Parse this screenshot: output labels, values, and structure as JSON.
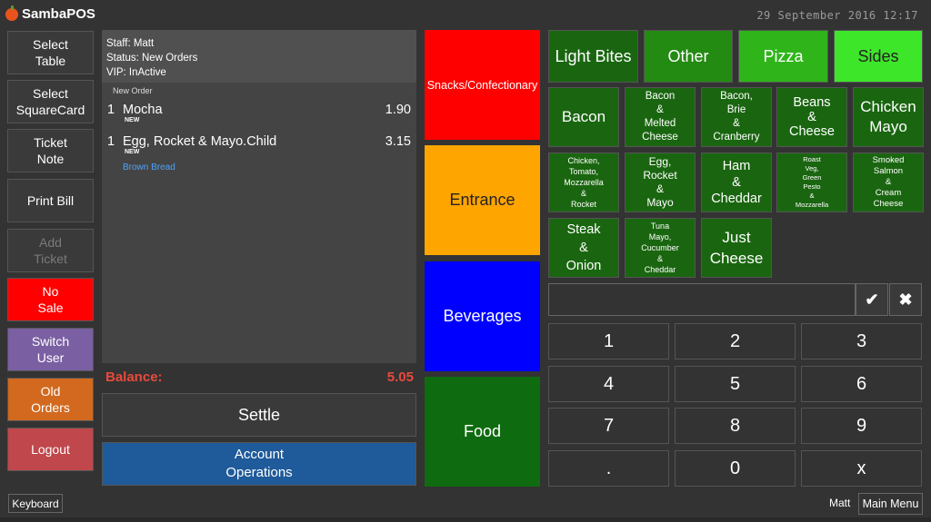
{
  "app": {
    "title": "SambaPOS",
    "datetime": "29 September 2016 12:17"
  },
  "left_buttons": [
    {
      "label": "Select\nTable",
      "color": "#3a3a3a"
    },
    {
      "label": "Select\nSquareCard",
      "color": "#3a3a3a"
    },
    {
      "label": "Ticket\nNote",
      "color": "#3a3a3a"
    },
    {
      "label": "Print Bill",
      "color": "#3a3a3a"
    },
    {
      "label": "Add\nTicket",
      "color": "#3a3a3a",
      "disabled": true
    },
    {
      "label": "No\nSale",
      "color": "#ff0000"
    },
    {
      "label": "Switch\nUser",
      "color": "#7b5fa3"
    },
    {
      "label": "Old\nOrders",
      "color": "#d2691e"
    },
    {
      "label": "Logout",
      "color": "#c0474b"
    }
  ],
  "ticket": {
    "staff": "Staff: Matt",
    "status": "Status: New Orders",
    "vip": "VIP: InActive",
    "section_label": "New Order",
    "orders": [
      {
        "qty": "1",
        "name": "Mocha",
        "price": "1.90",
        "tag": "NEW",
        "modifier": ""
      },
      {
        "qty": "1",
        "name": "Egg, Rocket & Mayo.Child",
        "price": "3.15",
        "tag": "NEW",
        "modifier": "Brown Bread"
      }
    ],
    "balance_label": "Balance:",
    "balance_value": "5.05",
    "settle_label": "Settle",
    "account_label": "Account\nOperations"
  },
  "categories": [
    {
      "label": "Snacks/Confectionary",
      "color": "#ff0000",
      "text_color": "#ffffff"
    },
    {
      "label": "Entrance",
      "color": "#ffa500",
      "text_color": "#222222"
    },
    {
      "label": "Beverages",
      "color": "#0000ff",
      "text_color": "#ffffff"
    },
    {
      "label": "Food",
      "color": "#0f6b0f",
      "text_color": "#ffffff"
    }
  ],
  "groups": [
    {
      "label": "Light Bites",
      "color": "#1a6610",
      "text_color": "#ffffff"
    },
    {
      "label": "Other",
      "color": "#238a12",
      "text_color": "#ffffff"
    },
    {
      "label": "Pizza",
      "color": "#2fb51a",
      "text_color": "#ffffff"
    },
    {
      "label": "Sides",
      "color": "#3ee62a",
      "text_color": "#222222"
    }
  ],
  "products": [
    {
      "label": "Bacon",
      "size": "big"
    },
    {
      "label": "Bacon\n&\nMelted\nCheese",
      "size": "small"
    },
    {
      "label": "Bacon,\nBrie\n&\nCranberry",
      "size": "small"
    },
    {
      "label": "Beans\n&\nCheese",
      "size": "mid"
    },
    {
      "label": "Chicken\nMayo",
      "size": "big"
    },
    {
      "label": "Chicken,\nTomato,\nMozzarella\n&\nRocket",
      "size": "tiny"
    },
    {
      "label": "Egg,\nRocket\n&\nMayo",
      "size": "small"
    },
    {
      "label": "Ham\n&\nCheddar",
      "size": "mid"
    },
    {
      "label": "Roast\nVeg,\nGreen\nPesto\n&\nMozzarella",
      "size": "micro"
    },
    {
      "label": "Smoked\nSalmon\n&\nCream\nCheese",
      "size": "tiny"
    },
    {
      "label": "Steak\n&\nOnion",
      "size": "mid"
    },
    {
      "label": "Tuna\nMayo,\nCucumber\n&\nCheddar",
      "size": "tiny"
    },
    {
      "label": "Just\nCheese",
      "size": "mid"
    }
  ],
  "numpad": {
    "input_value": "",
    "confirm_icon": "check-icon",
    "clear_icon": "close-icon",
    "confirm_glyph": "✔",
    "clear_glyph": "✖",
    "keys": [
      "1",
      "2",
      "3",
      "4",
      "5",
      "6",
      "7",
      "8",
      "9",
      ".",
      "0",
      "x"
    ]
  },
  "footer": {
    "keyboard_label": "Keyboard",
    "user": "Matt",
    "main_menu_label": "Main Menu"
  }
}
